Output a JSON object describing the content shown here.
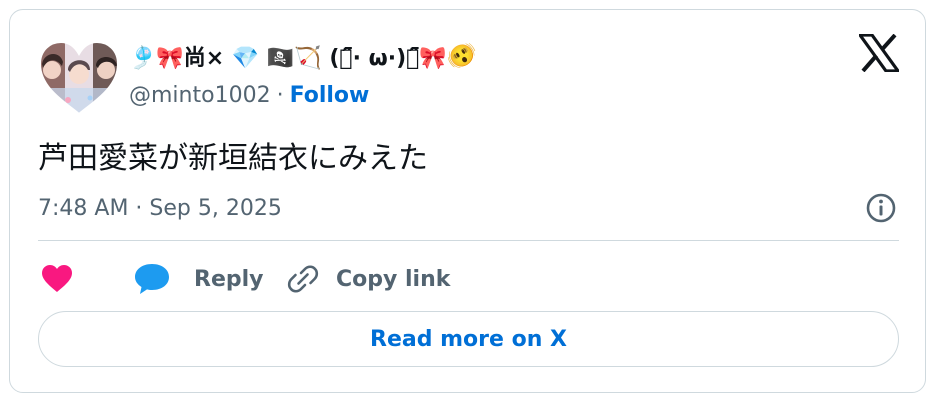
{
  "author": {
    "display_name_prefix": "🎐🎀尚× 💎 🏴‍☠️🏹 (꒡̈᷇· ω·)꒡̈᷇🎀",
    "display_name_emoji_tail": "🫨",
    "handle": "@minto1002",
    "separator": "·",
    "follow_label": "Follow"
  },
  "tweet": {
    "text": "芦田愛菜が新垣結衣にみえた",
    "timestamp": "7:48 AM · Sep 5, 2025"
  },
  "actions": {
    "reply_label": "Reply",
    "copy_link_label": "Copy link"
  },
  "read_more_label": "Read more on X",
  "colors": {
    "accent": "#006fd6",
    "like": "#f91880",
    "reply_bubble": "#1d9bf0",
    "secondary_text": "#536471",
    "border": "#cfd9de"
  },
  "icons": {
    "logo": "x-logo-icon",
    "info": "info-icon",
    "like": "heart-icon",
    "reply": "speech-bubble-icon",
    "copy": "link-icon"
  }
}
